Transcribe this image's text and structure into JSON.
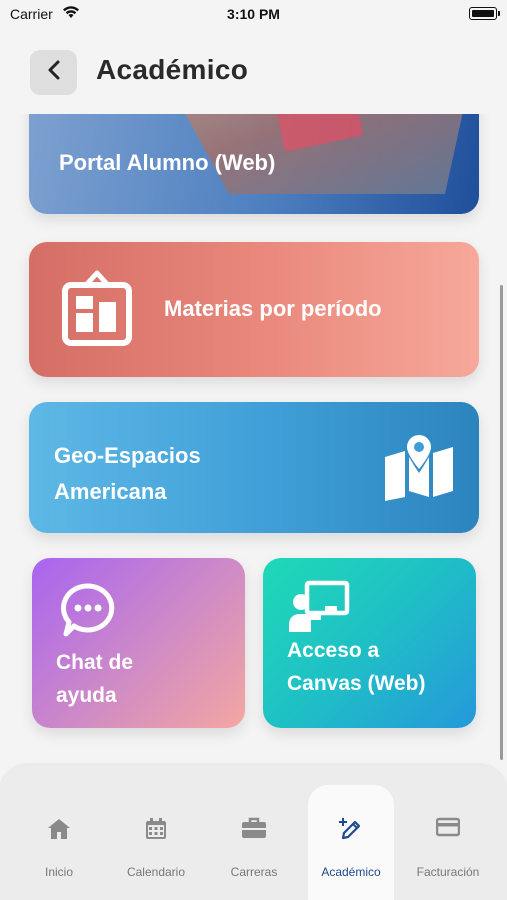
{
  "status_bar": {
    "carrier": "Carrier",
    "time": "3:10 PM"
  },
  "header": {
    "title": "Académico",
    "back_icon": "chevron-left-icon"
  },
  "cards": {
    "portal": {
      "label": "Portal Alumno (Web)"
    },
    "materias": {
      "label": "Materias por período",
      "icon": "board-icon"
    },
    "geo": {
      "line1": "Geo-Espacios",
      "line2": "Americana",
      "icon": "map-pin-icon"
    },
    "chat": {
      "line1": "Chat de",
      "line2": "ayuda",
      "icon": "chat-bubble-icon"
    },
    "canvas": {
      "line1": "Acceso a",
      "line2": "Canvas (Web)",
      "icon": "presentation-icon"
    }
  },
  "tab_bar": {
    "items": [
      {
        "label": "Inicio",
        "icon": "home-icon"
      },
      {
        "label": "Calendario",
        "icon": "calendar-icon"
      },
      {
        "label": "Carreras",
        "icon": "briefcase-icon"
      },
      {
        "label": "Académico",
        "icon": "pencil-sparkle-icon",
        "active": true
      },
      {
        "label": "Facturación",
        "icon": "card-icon"
      }
    ]
  },
  "colors": {
    "active_tab": "#1f4a8f",
    "inactive_tab": "#777777",
    "materias_from": "#d46e66",
    "materias_to": "#f6a89a",
    "geo_from": "#5eb8e6",
    "geo_to": "#2c84bd",
    "chat_from": "#a864f0",
    "chat_to": "#f4a7a2",
    "canvas_from": "#1fd9b6",
    "canvas_to": "#2598da"
  }
}
